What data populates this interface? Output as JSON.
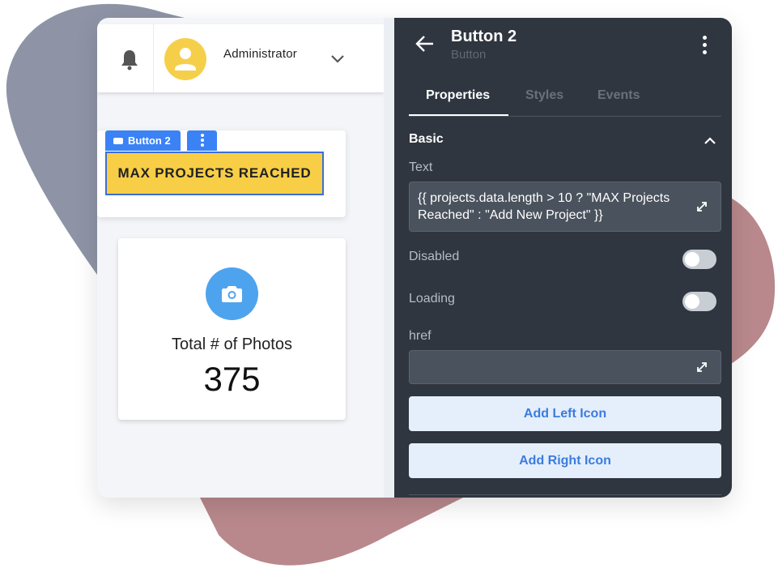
{
  "header": {
    "user_name": "Administrator"
  },
  "canvas": {
    "selected_component_tag": "Button 2",
    "button_text": "MAX PROJECTS REACHED",
    "stat_card": {
      "label": "Total # of Photos",
      "value": "375"
    }
  },
  "panel": {
    "title": "Button 2",
    "subtitle": "Button",
    "tabs": [
      {
        "label": "Properties",
        "active": true
      },
      {
        "label": "Styles",
        "active": false
      },
      {
        "label": "Events",
        "active": false
      }
    ],
    "section": "Basic",
    "fields": {
      "text": {
        "label": "Text",
        "value": "{{ projects.data.length > 10 ? \"MAX Projects Reached\" : \"Add New Project\" }}"
      },
      "disabled": {
        "label": "Disabled",
        "checked": false
      },
      "loading": {
        "label": "Loading",
        "checked": false
      },
      "href": {
        "label": "href",
        "value": ""
      }
    },
    "buttons": {
      "add_left_icon": "Add Left Icon",
      "add_right_icon": "Add Right Icon"
    }
  },
  "colors": {
    "panel_bg": "#2f3640",
    "accent_blue": "#3b82f6",
    "button_yellow": "#f7ce46",
    "avatar_yellow": "#f6cf4a",
    "camera_blue": "#4ea3ee",
    "decor_gray": "#8e94a6",
    "decor_rose": "#b8888c"
  },
  "icons": [
    "bell-icon",
    "user-icon",
    "chevron-down-icon",
    "camera-icon",
    "back-arrow-icon",
    "kebab-menu-icon",
    "chevron-up-icon",
    "expand-icon"
  ]
}
